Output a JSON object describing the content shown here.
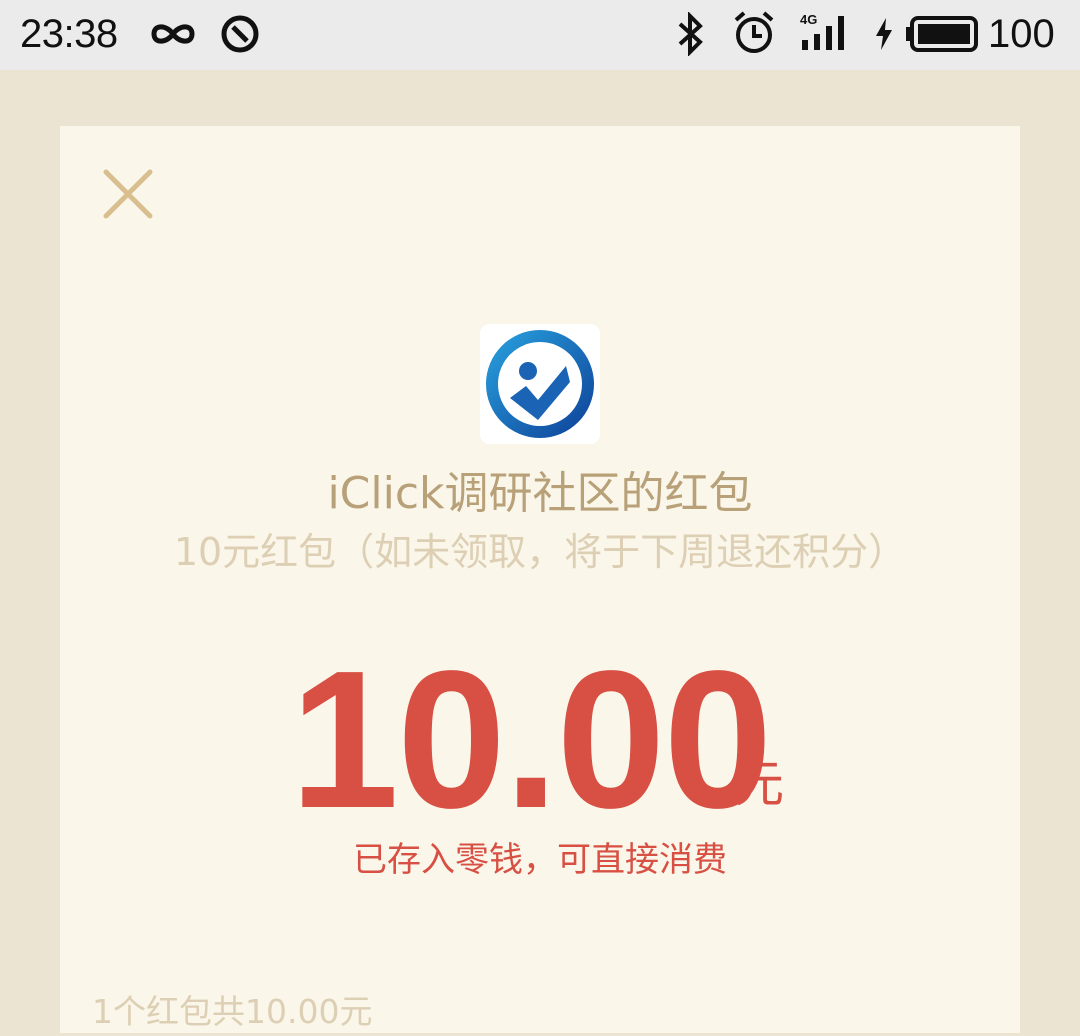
{
  "status_bar": {
    "time": "23:38",
    "network_label": "4G",
    "battery_level": "100",
    "icons": [
      "infinity-icon",
      "compass-icon",
      "bluetooth-icon",
      "alarm-icon",
      "signal-icon",
      "charging-icon",
      "battery-icon"
    ]
  },
  "red_packet": {
    "close_icon": "close-icon",
    "logo_icon": "iclick-logo-icon",
    "sender": "iClick调研社区的红包",
    "greeting": "10元红包（如未领取，将于下周退还积分）",
    "amount": "10.00",
    "unit": "元",
    "note": "已存入零钱，可直接消费",
    "summary": "1个红包共10.00元"
  },
  "colors": {
    "background": "#ece4d2",
    "card": "#faf6ea",
    "accent_red": "#d84f43",
    "gold_text": "#b8a178",
    "muted_text": "#ddcfb4",
    "close_icon": "#d9bf8f",
    "logo_blue": "#1a63b5"
  }
}
